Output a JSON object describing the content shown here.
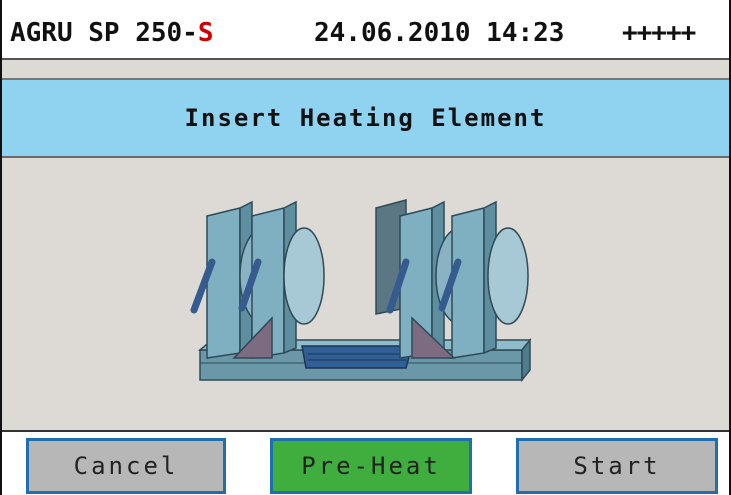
{
  "header": {
    "model_main": "AGRU SP 250-",
    "model_suffix": "S",
    "datetime": "24.06.2010 14:23",
    "signal": "+++++"
  },
  "banner": {
    "title": "Insert Heating Element"
  },
  "illustration": {
    "icon": "butt-fusion-welding-machine-icon"
  },
  "buttons": {
    "cancel": "Cancel",
    "preheat": "Pre-Heat",
    "start": "Start"
  },
  "colors": {
    "banner_bg": "#90d3f1",
    "preheat_active": "#3fae3f",
    "button_gray": "#b7b7b7",
    "button_border": "#1f6fb0",
    "model_suffix": "#d10000",
    "screen_bg": "#ddd9d4"
  }
}
